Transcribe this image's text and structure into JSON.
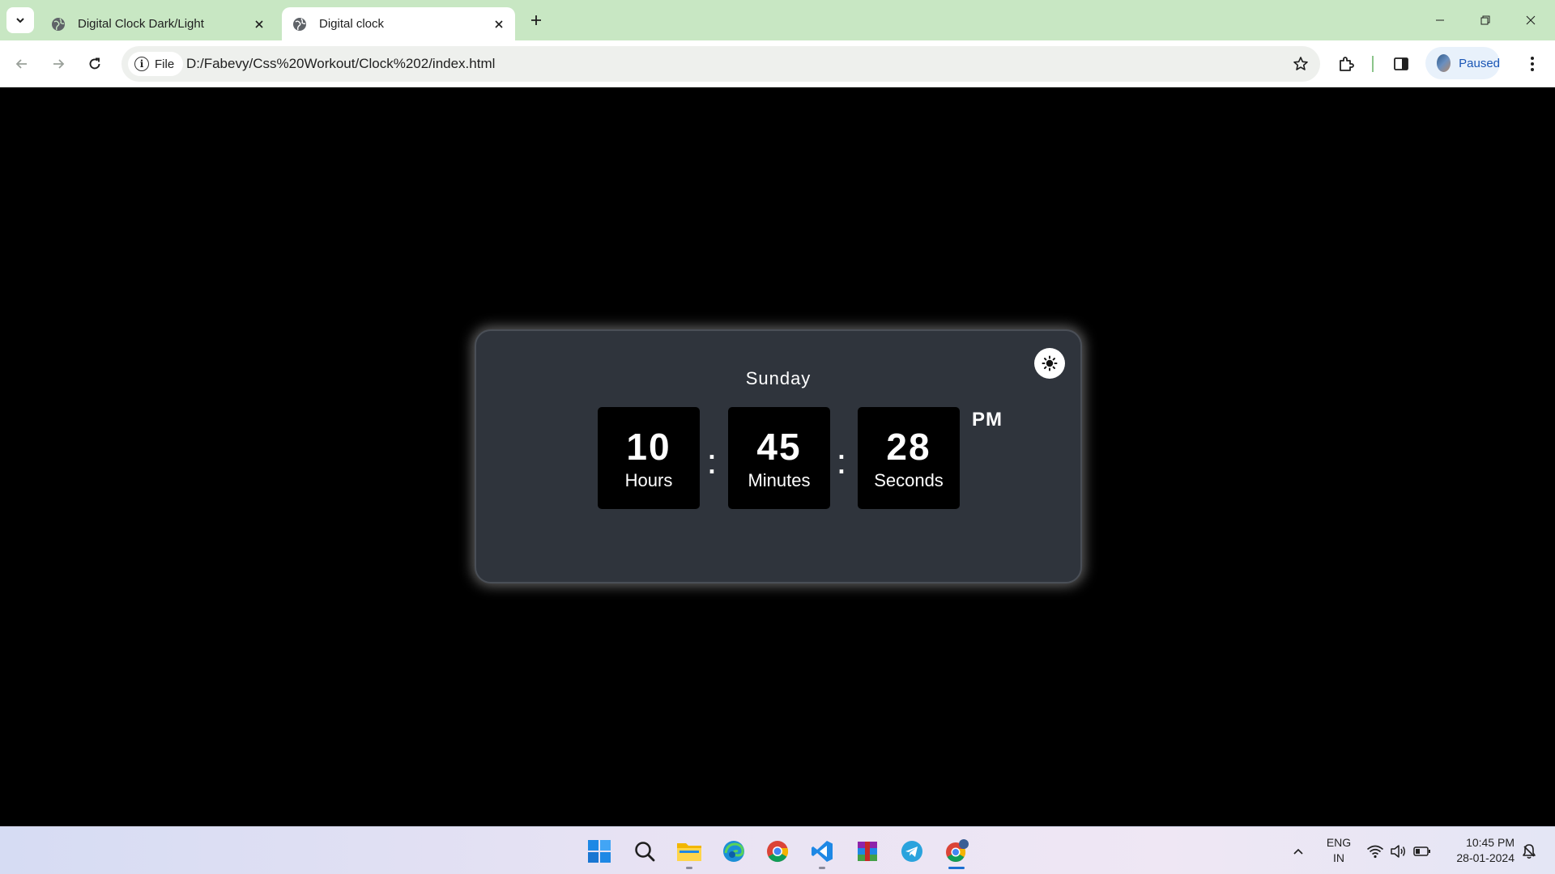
{
  "browser": {
    "tabs": [
      {
        "title": "Digital Clock Dark/Light",
        "active": false
      },
      {
        "title": "Digital clock",
        "active": true
      }
    ],
    "address": {
      "scheme_chip": "File",
      "url": "D:/Fabevy/Css%20Workout/Clock%202/index.html"
    },
    "profile": {
      "label": "Paused"
    }
  },
  "clock": {
    "day": "Sunday",
    "hours": {
      "value": "10",
      "label": "Hours"
    },
    "minutes": {
      "value": "45",
      "label": "Minutes"
    },
    "seconds": {
      "value": "28",
      "label": "Seconds"
    },
    "separator": ":",
    "meridiem": "PM",
    "theme_toggle_icon": "sun-icon"
  },
  "taskbar": {
    "apps": [
      "windows-start-icon",
      "search-icon",
      "file-explorer-icon",
      "edge-icon",
      "chrome-icon",
      "vscode-icon",
      "winrar-icon",
      "telegram-icon",
      "chrome-profile-icon"
    ],
    "language": {
      "line1": "ENG",
      "line2": "IN"
    },
    "time": "10:45 PM",
    "date": "28-01-2024"
  },
  "colors": {
    "tabstrip": "#c8e7c3",
    "card": "#2f343c",
    "page_bg": "#000000",
    "accent": "#1a6fd1"
  }
}
